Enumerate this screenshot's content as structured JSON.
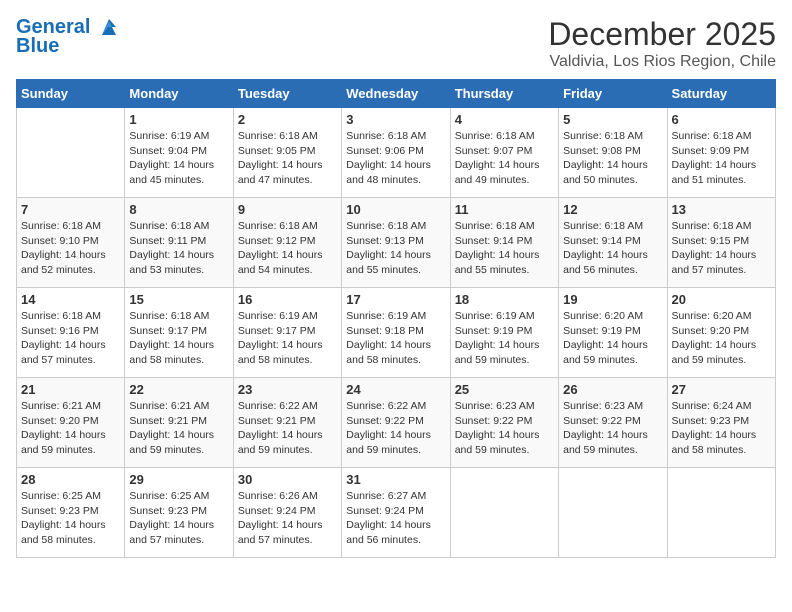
{
  "header": {
    "logo_line1": "General",
    "logo_line2": "Blue",
    "month": "December 2025",
    "location": "Valdivia, Los Rios Region, Chile"
  },
  "days_of_week": [
    "Sunday",
    "Monday",
    "Tuesday",
    "Wednesday",
    "Thursday",
    "Friday",
    "Saturday"
  ],
  "weeks": [
    [
      {
        "day": "",
        "sunrise": "",
        "sunset": "",
        "daylight": ""
      },
      {
        "day": "1",
        "sunrise": "Sunrise: 6:19 AM",
        "sunset": "Sunset: 9:04 PM",
        "daylight": "Daylight: 14 hours and 45 minutes."
      },
      {
        "day": "2",
        "sunrise": "Sunrise: 6:18 AM",
        "sunset": "Sunset: 9:05 PM",
        "daylight": "Daylight: 14 hours and 47 minutes."
      },
      {
        "day": "3",
        "sunrise": "Sunrise: 6:18 AM",
        "sunset": "Sunset: 9:06 PM",
        "daylight": "Daylight: 14 hours and 48 minutes."
      },
      {
        "day": "4",
        "sunrise": "Sunrise: 6:18 AM",
        "sunset": "Sunset: 9:07 PM",
        "daylight": "Daylight: 14 hours and 49 minutes."
      },
      {
        "day": "5",
        "sunrise": "Sunrise: 6:18 AM",
        "sunset": "Sunset: 9:08 PM",
        "daylight": "Daylight: 14 hours and 50 minutes."
      },
      {
        "day": "6",
        "sunrise": "Sunrise: 6:18 AM",
        "sunset": "Sunset: 9:09 PM",
        "daylight": "Daylight: 14 hours and 51 minutes."
      }
    ],
    [
      {
        "day": "7",
        "sunrise": "Sunrise: 6:18 AM",
        "sunset": "Sunset: 9:10 PM",
        "daylight": "Daylight: 14 hours and 52 minutes."
      },
      {
        "day": "8",
        "sunrise": "Sunrise: 6:18 AM",
        "sunset": "Sunset: 9:11 PM",
        "daylight": "Daylight: 14 hours and 53 minutes."
      },
      {
        "day": "9",
        "sunrise": "Sunrise: 6:18 AM",
        "sunset": "Sunset: 9:12 PM",
        "daylight": "Daylight: 14 hours and 54 minutes."
      },
      {
        "day": "10",
        "sunrise": "Sunrise: 6:18 AM",
        "sunset": "Sunset: 9:13 PM",
        "daylight": "Daylight: 14 hours and 55 minutes."
      },
      {
        "day": "11",
        "sunrise": "Sunrise: 6:18 AM",
        "sunset": "Sunset: 9:14 PM",
        "daylight": "Daylight: 14 hours and 55 minutes."
      },
      {
        "day": "12",
        "sunrise": "Sunrise: 6:18 AM",
        "sunset": "Sunset: 9:14 PM",
        "daylight": "Daylight: 14 hours and 56 minutes."
      },
      {
        "day": "13",
        "sunrise": "Sunrise: 6:18 AM",
        "sunset": "Sunset: 9:15 PM",
        "daylight": "Daylight: 14 hours and 57 minutes."
      }
    ],
    [
      {
        "day": "14",
        "sunrise": "Sunrise: 6:18 AM",
        "sunset": "Sunset: 9:16 PM",
        "daylight": "Daylight: 14 hours and 57 minutes."
      },
      {
        "day": "15",
        "sunrise": "Sunrise: 6:18 AM",
        "sunset": "Sunset: 9:17 PM",
        "daylight": "Daylight: 14 hours and 58 minutes."
      },
      {
        "day": "16",
        "sunrise": "Sunrise: 6:19 AM",
        "sunset": "Sunset: 9:17 PM",
        "daylight": "Daylight: 14 hours and 58 minutes."
      },
      {
        "day": "17",
        "sunrise": "Sunrise: 6:19 AM",
        "sunset": "Sunset: 9:18 PM",
        "daylight": "Daylight: 14 hours and 58 minutes."
      },
      {
        "day": "18",
        "sunrise": "Sunrise: 6:19 AM",
        "sunset": "Sunset: 9:19 PM",
        "daylight": "Daylight: 14 hours and 59 minutes."
      },
      {
        "day": "19",
        "sunrise": "Sunrise: 6:20 AM",
        "sunset": "Sunset: 9:19 PM",
        "daylight": "Daylight: 14 hours and 59 minutes."
      },
      {
        "day": "20",
        "sunrise": "Sunrise: 6:20 AM",
        "sunset": "Sunset: 9:20 PM",
        "daylight": "Daylight: 14 hours and 59 minutes."
      }
    ],
    [
      {
        "day": "21",
        "sunrise": "Sunrise: 6:21 AM",
        "sunset": "Sunset: 9:20 PM",
        "daylight": "Daylight: 14 hours and 59 minutes."
      },
      {
        "day": "22",
        "sunrise": "Sunrise: 6:21 AM",
        "sunset": "Sunset: 9:21 PM",
        "daylight": "Daylight: 14 hours and 59 minutes."
      },
      {
        "day": "23",
        "sunrise": "Sunrise: 6:22 AM",
        "sunset": "Sunset: 9:21 PM",
        "daylight": "Daylight: 14 hours and 59 minutes."
      },
      {
        "day": "24",
        "sunrise": "Sunrise: 6:22 AM",
        "sunset": "Sunset: 9:22 PM",
        "daylight": "Daylight: 14 hours and 59 minutes."
      },
      {
        "day": "25",
        "sunrise": "Sunrise: 6:23 AM",
        "sunset": "Sunset: 9:22 PM",
        "daylight": "Daylight: 14 hours and 59 minutes."
      },
      {
        "day": "26",
        "sunrise": "Sunrise: 6:23 AM",
        "sunset": "Sunset: 9:22 PM",
        "daylight": "Daylight: 14 hours and 59 minutes."
      },
      {
        "day": "27",
        "sunrise": "Sunrise: 6:24 AM",
        "sunset": "Sunset: 9:23 PM",
        "daylight": "Daylight: 14 hours and 58 minutes."
      }
    ],
    [
      {
        "day": "28",
        "sunrise": "Sunrise: 6:25 AM",
        "sunset": "Sunset: 9:23 PM",
        "daylight": "Daylight: 14 hours and 58 minutes."
      },
      {
        "day": "29",
        "sunrise": "Sunrise: 6:25 AM",
        "sunset": "Sunset: 9:23 PM",
        "daylight": "Daylight: 14 hours and 57 minutes."
      },
      {
        "day": "30",
        "sunrise": "Sunrise: 6:26 AM",
        "sunset": "Sunset: 9:24 PM",
        "daylight": "Daylight: 14 hours and 57 minutes."
      },
      {
        "day": "31",
        "sunrise": "Sunrise: 6:27 AM",
        "sunset": "Sunset: 9:24 PM",
        "daylight": "Daylight: 14 hours and 56 minutes."
      },
      {
        "day": "",
        "sunrise": "",
        "sunset": "",
        "daylight": ""
      },
      {
        "day": "",
        "sunrise": "",
        "sunset": "",
        "daylight": ""
      },
      {
        "day": "",
        "sunrise": "",
        "sunset": "",
        "daylight": ""
      }
    ]
  ]
}
